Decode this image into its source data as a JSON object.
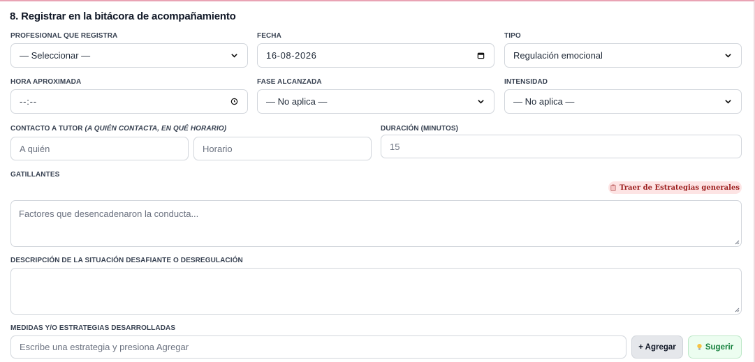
{
  "section": {
    "title": "8. Registrar en la bitácora de acompañamiento"
  },
  "profesional": {
    "label": "PROFESIONAL QUE REGISTRA",
    "value": "— Seleccionar —"
  },
  "fecha": {
    "label": "FECHA",
    "value": "16-08-2026"
  },
  "tipo": {
    "label": "TIPO",
    "value": "Regulación emocional"
  },
  "hora": {
    "label": "HORA APROXIMADA",
    "value": "--:--"
  },
  "fase": {
    "label": "FASE ALCANZADA",
    "value": "— No aplica —"
  },
  "intensidad": {
    "label": "INTENSIDAD",
    "value": "— No aplica —"
  },
  "contacto": {
    "label": "CONTACTO A TUTOR",
    "label_hint": "(A QUIÉN CONTACTA, EN QUÉ HORARIO)",
    "quien_placeholder": "A quién",
    "horario_placeholder": "Horario"
  },
  "duracion": {
    "label": "DURACIÓN (MINUTOS)",
    "value": "15"
  },
  "gatillantes": {
    "label": "GATILLANTES",
    "action_label": "Traer de Estrategias generales",
    "action_icon": "clipboard-icon",
    "placeholder": "Factores que desencadenaron la conducta..."
  },
  "descripcion": {
    "label": "DESCRIPCIÓN DE LA SITUACIÓN DESAFIANTE O DESREGULACIÓN",
    "placeholder": ""
  },
  "medidas": {
    "label": "MEDIDAS Y/O ESTRATEGIAS DESARROLLADAS",
    "placeholder": "Escribe una estrategia y presiona Agregar",
    "add_label": "+ Agregar",
    "suggest_label": "Sugerir",
    "suggest_icon": "lightbulb-icon"
  },
  "colors": {
    "accent_pink": "#e9a3b4",
    "pill_bg": "#fde4e4",
    "pill_text": "#9b1c1c",
    "suggest_text": "#15803d"
  }
}
